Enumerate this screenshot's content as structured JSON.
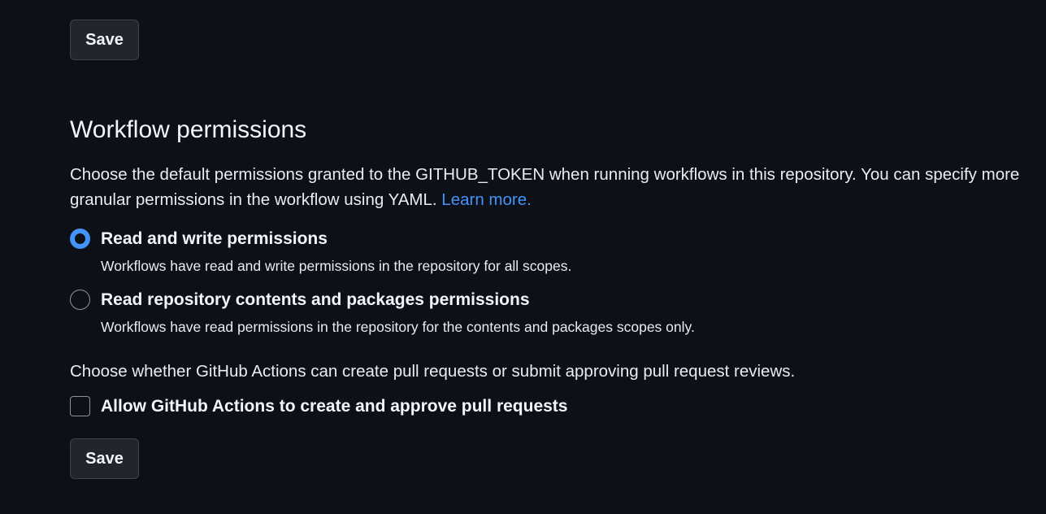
{
  "top_save": {
    "label": "Save"
  },
  "workflow_permissions": {
    "title": "Workflow permissions",
    "description": "Choose the default permissions granted to the GITHUB_TOKEN when running workflows in this repository. You can specify more granular permissions in the workflow using YAML.",
    "learn_more": "Learn more.",
    "options": [
      {
        "label": "Read and write permissions",
        "description": "Workflows have read and write permissions in the repository for all scopes.",
        "selected": true
      },
      {
        "label": "Read repository contents and packages permissions",
        "description": "Workflows have read permissions in the repository for the contents and packages scopes only.",
        "selected": false
      }
    ]
  },
  "pull_requests": {
    "description": "Choose whether GitHub Actions can create pull requests or submit approving pull request reviews.",
    "checkbox_label": "Allow GitHub Actions to create and approve pull requests",
    "checked": false
  },
  "bottom_save": {
    "label": "Save"
  },
  "colors": {
    "background": "#0d1117",
    "button_bg": "#21262d",
    "accent": "#4493f8",
    "text": "#e6edf3"
  }
}
